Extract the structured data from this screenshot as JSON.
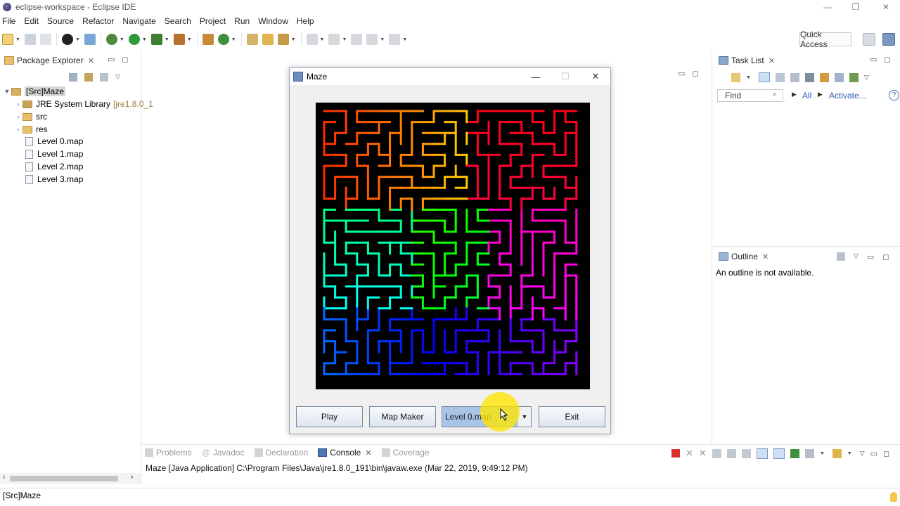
{
  "window": {
    "title": "eclipse-workspace - Eclipse IDE",
    "controls": [
      "—",
      "❐",
      "✕"
    ]
  },
  "menubar": [
    "File",
    "Edit",
    "Source",
    "Refactor",
    "Navigate",
    "Search",
    "Project",
    "Run",
    "Window",
    "Help"
  ],
  "toolbar": {
    "quick_access": "Quick Access"
  },
  "package_explorer": {
    "title": "Package Explorer",
    "project": "[Src]Maze",
    "items": [
      {
        "label": "JRE System Library",
        "suffix": "[jre1.8.0_1",
        "kind": "library"
      },
      {
        "label": "src",
        "kind": "folder"
      },
      {
        "label": "res",
        "kind": "folder"
      },
      {
        "label": "Level 0.map",
        "kind": "file"
      },
      {
        "label": "Level 1.map",
        "kind": "file"
      },
      {
        "label": "Level 2.map",
        "kind": "file"
      },
      {
        "label": "Level 3.map",
        "kind": "file"
      }
    ]
  },
  "task_list": {
    "title": "Task List",
    "find_placeholder": "Find",
    "all_label": "All",
    "activate_label": "Activate..."
  },
  "outline": {
    "title": "Outline",
    "message": "An outline is not available."
  },
  "maze_window": {
    "title": "Maze",
    "buttons": {
      "play": "Play",
      "map_maker": "Map Maker",
      "exit": "Exit"
    },
    "level_select": "Level 0.map"
  },
  "bottom_tabs": [
    "Problems",
    "Javadoc",
    "Declaration",
    "Console",
    "Coverage"
  ],
  "console": {
    "active_tab": "Console",
    "line": "Maze [Java Application] C:\\Program Files\\Java\\jre1.8.0_191\\bin\\javaw.exe (Mar 22, 2019, 9:49:12 PM)"
  },
  "status_bar": {
    "text": "[Src]Maze"
  },
  "colors": {
    "maze_background": "#000000",
    "selection": "#a9c4e6",
    "cursor_highlight": "#ffe600"
  }
}
